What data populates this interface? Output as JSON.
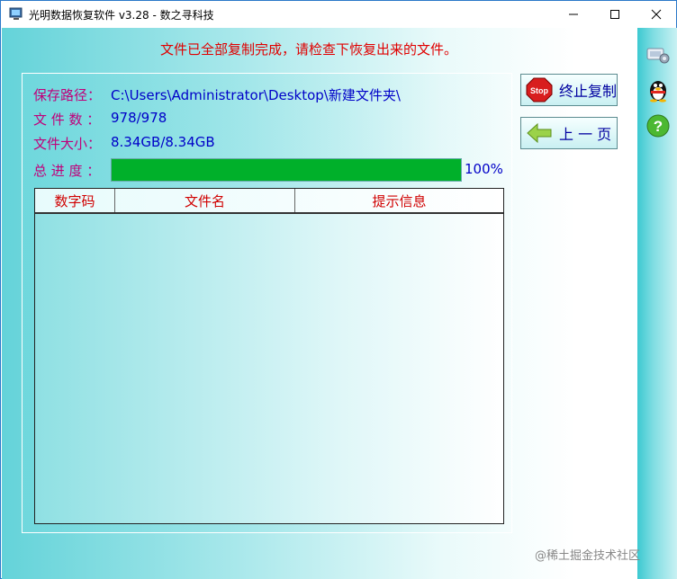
{
  "window": {
    "title": "光明数据恢复软件 v3.28 - 数之寻科技"
  },
  "status_message": "文件已全部复制完成，请检查下恢复出来的文件。",
  "info": {
    "save_path_label": "保存路径：",
    "save_path_value": "C:\\Users\\Administrator\\Desktop\\新建文件夹\\",
    "file_count_label": "文 件 数 ：",
    "file_count_value": "978/978",
    "file_size_label": "文件大小：",
    "file_size_value": "8.34GB/8.34GB",
    "progress_label": "总 进 度 ：",
    "progress_text": "100%",
    "progress_fraction": 1.0
  },
  "table": {
    "columns": [
      "数字码",
      "文件名",
      "提示信息"
    ],
    "rows": []
  },
  "buttons": {
    "stop_label": "终止复制",
    "back_label": "上 一 页"
  },
  "sidebar_icons": [
    "settings-icon",
    "qq-penguin-icon",
    "help-icon"
  ],
  "watermark": "@稀土掘金技术社区",
  "colors": {
    "status_red": "#e00000",
    "label_magenta": "#c0007a",
    "value_blue": "#0000c8",
    "progress_green": "#00b02a"
  }
}
